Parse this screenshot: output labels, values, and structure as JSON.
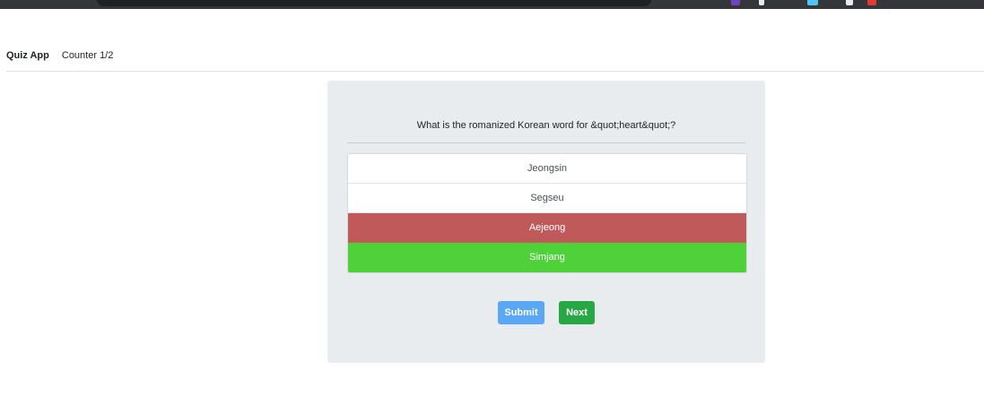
{
  "navbar": {
    "brand": "Quiz App",
    "counter": "Counter 1/2"
  },
  "quiz": {
    "question": "What is the romanized Korean word for &quot;heart&quot;?",
    "answers": [
      {
        "label": "Jeongsin",
        "state": "neutral"
      },
      {
        "label": "Segseu",
        "state": "neutral"
      },
      {
        "label": "Aejeong",
        "state": "wrong"
      },
      {
        "label": "Simjang",
        "state": "correct"
      }
    ],
    "submit_label": "Submit",
    "next_label": "Next"
  },
  "colors": {
    "wrong": "#c05a5a",
    "correct": "#4fd13a",
    "submit": "#5aa7f5",
    "next": "#28a745",
    "card_bg": "#e9ecef"
  }
}
